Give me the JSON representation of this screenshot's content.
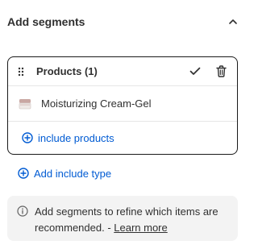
{
  "header": {
    "title": "Add segments",
    "collapse_icon": "chevron-up-icon"
  },
  "segment_card": {
    "title": "Products (1)",
    "drag_icon": "drag-handle-icon",
    "confirm_icon": "checkmark-icon",
    "delete_icon": "trash-icon",
    "products": [
      {
        "name": "Moisturizing Cream-Gel",
        "thumbnail_icon": "cream-jar-thumbnail"
      }
    ],
    "include_label": "include products",
    "include_icon": "plus-circle-icon"
  },
  "add_include_type": {
    "label": "Add include type",
    "icon": "plus-circle-icon"
  },
  "info": {
    "icon": "info-icon",
    "text": "Add segments to refine which items are recommended. - ",
    "link_label": "Learn more"
  },
  "colors": {
    "link": "#005bd3",
    "text": "#303030",
    "border": "#1a1a1a",
    "info_bg": "#f3f3f3"
  }
}
